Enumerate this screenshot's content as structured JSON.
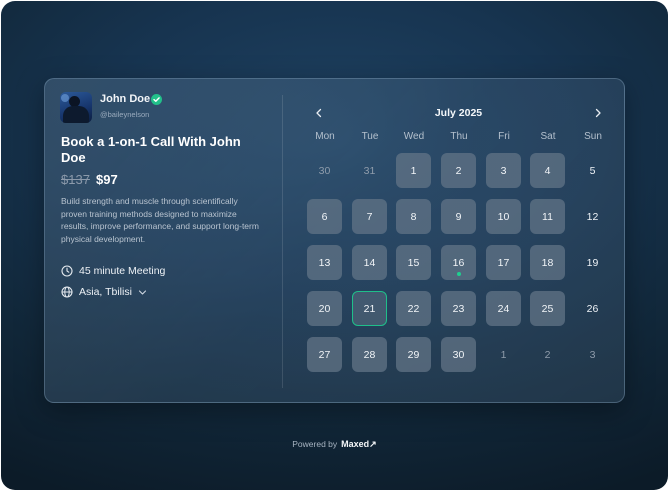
{
  "profile": {
    "name": "John Doe",
    "handle": "@baileynelson",
    "avatar_icon": "person-photo"
  },
  "offer": {
    "title": "Book a 1-on-1 Call With John Doe",
    "old_price": "$137",
    "price": "$97",
    "description": "Build strength and muscle through scientifically proven training methods designed to maximize results, improve performance, and support long-term physical development.",
    "duration": "45 minute Meeting",
    "timezone": "Asia, Tbilisi"
  },
  "calendar": {
    "month_label": "July 2025",
    "weekdays": [
      "Mon",
      "Tue",
      "Wed",
      "Thu",
      "Fri",
      "Sat",
      "Sun"
    ],
    "weeks": [
      [
        {
          "d": "30",
          "s": "muted"
        },
        {
          "d": "31",
          "s": "muted"
        },
        {
          "d": "1",
          "s": "avail"
        },
        {
          "d": "2",
          "s": "avail"
        },
        {
          "d": "3",
          "s": "avail"
        },
        {
          "d": "4",
          "s": "avail"
        },
        {
          "d": "5",
          "s": "plain"
        }
      ],
      [
        {
          "d": "6",
          "s": "avail"
        },
        {
          "d": "7",
          "s": "avail"
        },
        {
          "d": "8",
          "s": "avail"
        },
        {
          "d": "9",
          "s": "avail"
        },
        {
          "d": "10",
          "s": "avail"
        },
        {
          "d": "11",
          "s": "avail"
        },
        {
          "d": "12",
          "s": "plain"
        }
      ],
      [
        {
          "d": "13",
          "s": "avail"
        },
        {
          "d": "14",
          "s": "avail"
        },
        {
          "d": "15",
          "s": "avail"
        },
        {
          "d": "16",
          "s": "avail",
          "today": true
        },
        {
          "d": "17",
          "s": "avail"
        },
        {
          "d": "18",
          "s": "avail"
        },
        {
          "d": "19",
          "s": "plain"
        }
      ],
      [
        {
          "d": "20",
          "s": "avail"
        },
        {
          "d": "21",
          "s": "avail",
          "selected": true
        },
        {
          "d": "22",
          "s": "avail"
        },
        {
          "d": "23",
          "s": "avail"
        },
        {
          "d": "24",
          "s": "avail"
        },
        {
          "d": "25",
          "s": "avail"
        },
        {
          "d": "26",
          "s": "plain"
        }
      ],
      [
        {
          "d": "27",
          "s": "avail"
        },
        {
          "d": "28",
          "s": "avail"
        },
        {
          "d": "29",
          "s": "avail"
        },
        {
          "d": "30",
          "s": "avail"
        },
        {
          "d": "1",
          "s": "muted"
        },
        {
          "d": "2",
          "s": "muted"
        },
        {
          "d": "3",
          "s": "muted"
        }
      ]
    ]
  },
  "footer": {
    "powered_label": "Powered by",
    "brand": "Maxed↗"
  },
  "colors": {
    "accent": "#1fbf8a",
    "verified": "#22c08a"
  }
}
